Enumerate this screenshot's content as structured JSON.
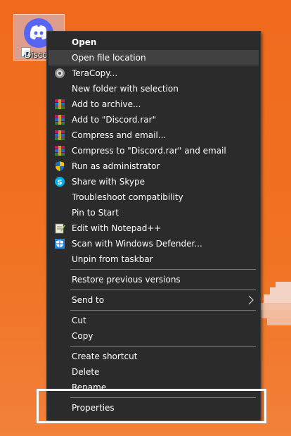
{
  "desktop": {
    "shortcut_label": "Discord"
  },
  "menu": {
    "items": [
      {
        "label": "Open",
        "icon": "",
        "bold": true
      },
      {
        "label": "Open file location",
        "icon": "",
        "hover": true
      },
      {
        "label": "TeraCopy...",
        "icon": "teracopy-icon"
      },
      {
        "label": "New folder with selection",
        "icon": ""
      },
      {
        "label": "Add to archive...",
        "icon": "winrar-icon"
      },
      {
        "label": "Add to \"Discord.rar\"",
        "icon": "winrar-icon"
      },
      {
        "label": "Compress and email...",
        "icon": "winrar-icon"
      },
      {
        "label": "Compress to \"Discord.rar\" and email",
        "icon": "winrar-icon"
      },
      {
        "label": "Run as administrator",
        "icon": "uac-shield-icon"
      },
      {
        "label": "Share with Skype",
        "icon": "skype-icon"
      },
      {
        "label": "Troubleshoot compatibility",
        "icon": ""
      },
      {
        "label": "Pin to Start",
        "icon": ""
      },
      {
        "label": "Edit with Notepad++",
        "icon": "notepadpp-icon"
      },
      {
        "label": "Scan with Windows Defender...",
        "icon": "defender-icon"
      },
      {
        "label": "Unpin from taskbar",
        "icon": ""
      },
      {
        "label": "Restore previous versions",
        "icon": ""
      },
      {
        "label": "Send to",
        "icon": "",
        "submenu": true
      },
      {
        "label": "Cut",
        "icon": ""
      },
      {
        "label": "Copy",
        "icon": ""
      },
      {
        "label": "Create shortcut",
        "icon": ""
      },
      {
        "label": "Delete",
        "icon": ""
      },
      {
        "label": "Rename",
        "icon": ""
      },
      {
        "label": "Properties",
        "icon": ""
      }
    ]
  },
  "colors": {
    "desktop_orange": "#f06a1e",
    "menu_bg": "#2b2b2b",
    "menu_hover": "#414141",
    "discord_blurple": "#5865f2",
    "highlight_border": "#ffffff"
  }
}
